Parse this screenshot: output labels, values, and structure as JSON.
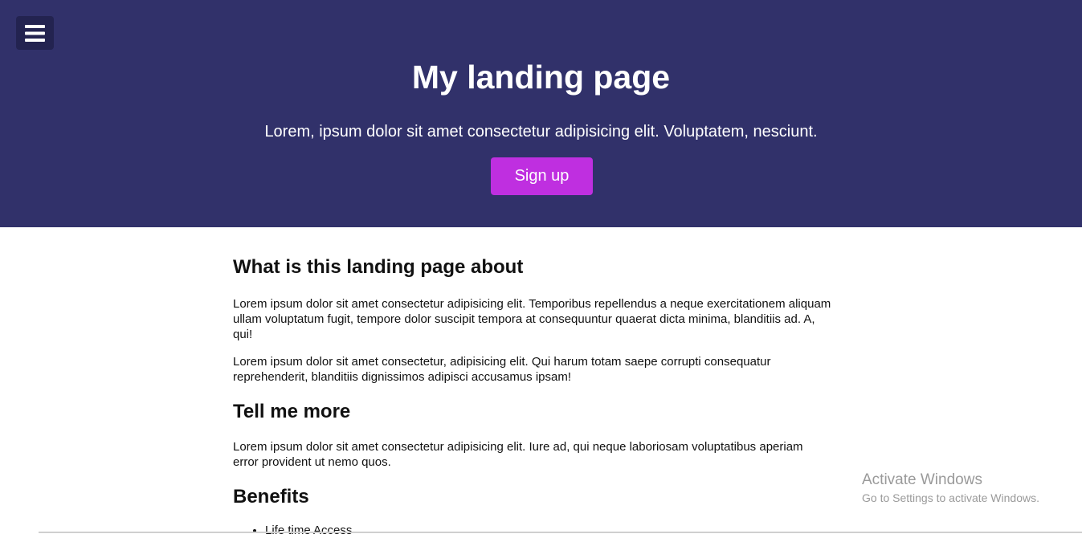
{
  "hero": {
    "menu_icon": "hamburger-menu-icon",
    "title": "My landing page",
    "subtitle": "Lorem, ipsum dolor sit amet consectetur adipisicing elit. Voluptatem, nesciunt.",
    "signup_label": "Sign up",
    "background_color": "#31316a",
    "button_color": "#bf2fe0"
  },
  "sections": {
    "about": {
      "heading": "What is this landing page about",
      "paragraph_1": "Lorem ipsum dolor sit amet consectetur adipisicing elit. Temporibus repellendus a neque exercitationem aliquam ullam voluptatum fugit, tempore dolor suscipit tempora at consequuntur quaerat dicta minima, blanditiis ad. A, qui!",
      "paragraph_2": "Lorem ipsum dolor sit amet consectetur, adipisicing elit. Qui harum totam saepe corrupti consequatur reprehenderit, blanditiis dignissimos adipisci accusamus ipsam!"
    },
    "more": {
      "heading": "Tell me more",
      "paragraph": "Lorem ipsum dolor sit amet consectetur adipisicing elit. Iure ad, qui neque laboriosam voluptatibus aperiam error provident ut nemo quos."
    },
    "benefits": {
      "heading": "Benefits",
      "items": [
        "Life time Access"
      ]
    }
  },
  "watermark": {
    "title": "Activate Windows",
    "subtitle": "Go to Settings to activate Windows."
  }
}
